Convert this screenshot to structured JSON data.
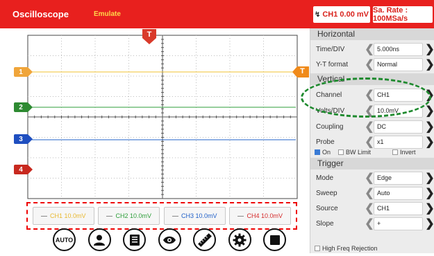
{
  "app": {
    "title": "Oscilloscope",
    "mode": "Emulate"
  },
  "top": {
    "trigger_label": "CH1 0.00 mV",
    "rate_label": "Sa. Rate : 100MSa/s"
  },
  "markers": {
    "trigger_pos": "T",
    "trigger_level": "T",
    "ch1": "1",
    "ch2": "2",
    "ch3": "3",
    "ch4": "4"
  },
  "channels": [
    {
      "label": "CH1 10.0mV",
      "color": "#f1c232"
    },
    {
      "label": "CH2 10.0mV",
      "color": "#2e9e3a"
    },
    {
      "label": "CH3 10.0mV",
      "color": "#2060c8"
    },
    {
      "label": "CH4 10.0mV",
      "color": "#d42a2a"
    }
  ],
  "toolbar": {
    "auto": "AUTO"
  },
  "horizontal": {
    "title": "Horizontal",
    "time_div_label": "Time/DIV",
    "time_div_value": "5.000ns",
    "yt_label": "Y-T format",
    "yt_value": "Normal"
  },
  "vertical": {
    "title": "Vertical",
    "channel_label": "Channel",
    "channel_value": "CH1",
    "volts_label": "Volts/DIV",
    "volts_value": "10.0mV",
    "coupling_label": "Coupling",
    "coupling_value": "DC",
    "probe_label": "Probe",
    "probe_value": "x1",
    "on_label": "On",
    "bw_label": "BW Limit",
    "invert_label": "Invert"
  },
  "trigger": {
    "title": "Trigger",
    "mode_label": "Mode",
    "mode_value": "Edge",
    "sweep_label": "Sweep",
    "sweep_value": "Auto",
    "source_label": "Source",
    "source_value": "CH1",
    "slope_label": "Slope",
    "slope_value": "+"
  },
  "hf_reject_label": "High Freq Rejection",
  "colors": {
    "header": "#e8201e",
    "ch1": "#f1c232",
    "ch2": "#2e9e3a",
    "ch3": "#2060c8",
    "ch4": "#d42a2a",
    "trigger": "#d93a2a"
  }
}
